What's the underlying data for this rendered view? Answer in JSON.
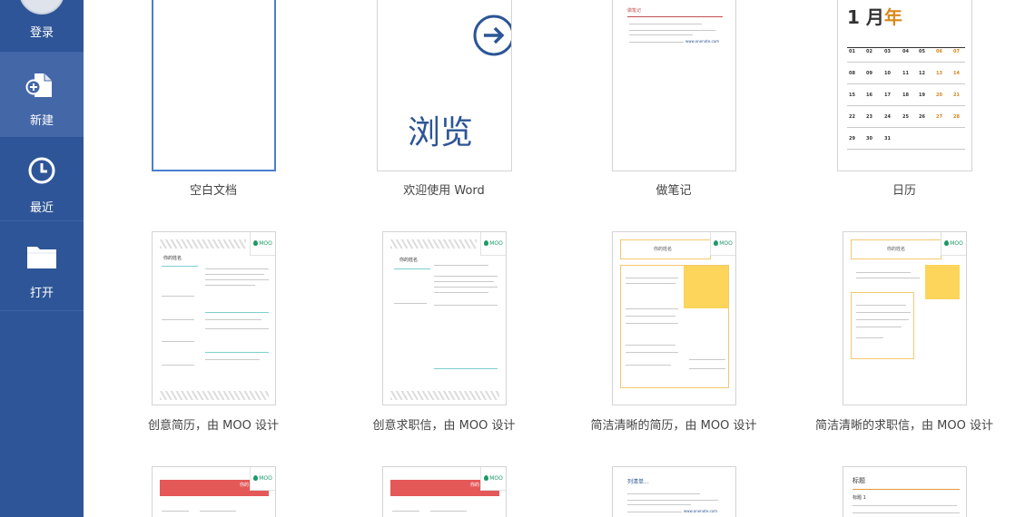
{
  "sidebar": {
    "items": [
      {
        "label": "登录",
        "icon": "user-avatar-icon"
      },
      {
        "label": "新建",
        "icon": "new-document-icon",
        "active": true
      },
      {
        "label": "最近",
        "icon": "clock-icon"
      },
      {
        "label": "打开",
        "icon": "folder-icon"
      }
    ]
  },
  "templates": {
    "row1": [
      {
        "caption": "空白文档"
      },
      {
        "caption": "欢迎使用 Word",
        "preview_text": "浏览"
      },
      {
        "caption": "做笔记",
        "preview_title": "做笔记",
        "link_text": "www.onenote.com"
      },
      {
        "caption": "日历",
        "month": "1 月",
        "year": "年"
      }
    ],
    "row2": [
      {
        "caption": "创意简历，由 MOO 设计",
        "preview_name": "你的姓名"
      },
      {
        "caption": "创意求职信，由 MOO 设计",
        "preview_name": "你的姓名"
      },
      {
        "caption": "简洁清晰的简历，由 MOO 设计",
        "preview_name": "你的姓名"
      },
      {
        "caption": "简洁清晰的求职信，由 MOO 设计",
        "preview_name": "你的姓名"
      }
    ],
    "row3": [
      {
        "preview_name": "你的"
      },
      {
        "preview_name": "你的"
      },
      {
        "preview_title": "列清单...",
        "link_text": "www.onenote.com"
      },
      {
        "preview_title": "标题",
        "preview_heading": "标题 1"
      }
    ]
  },
  "moo_label": "MOO",
  "calendar": {
    "days": [
      [
        "01",
        "02",
        "03",
        "04",
        "05",
        "06",
        "07"
      ],
      [
        "08",
        "09",
        "10",
        "11",
        "12",
        "13",
        "14"
      ],
      [
        "15",
        "16",
        "17",
        "18",
        "19",
        "20",
        "21"
      ],
      [
        "22",
        "23",
        "24",
        "25",
        "26",
        "27",
        "28"
      ],
      [
        "29",
        "30",
        "31",
        "",
        "",
        "",
        ""
      ]
    ]
  },
  "colors": {
    "sidebar": "#2e5597",
    "sidebar_active": "#4467a7",
    "selection": "#4a7fd0",
    "accent_blue": "#2c5596",
    "moo_green": "#1c9a67",
    "orange": "#d98a1b"
  }
}
